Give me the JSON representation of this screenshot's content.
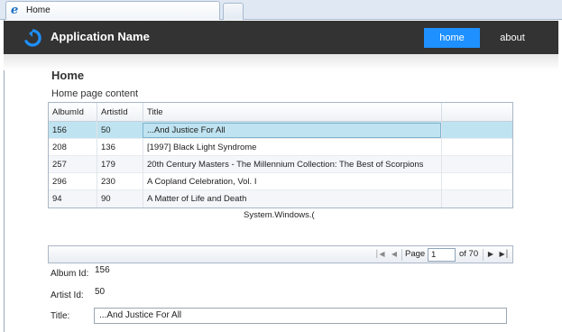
{
  "browser": {
    "tab_label": "Home"
  },
  "header": {
    "app_name": "Application Name",
    "nav": [
      {
        "label": "home",
        "active": true
      },
      {
        "label": "about",
        "active": false
      }
    ],
    "accent": "#1e90ff"
  },
  "page": {
    "title": "Home",
    "content": "Home page content"
  },
  "grid": {
    "columns": [
      "AlbumId",
      "ArtistId",
      "Title"
    ],
    "rows": [
      {
        "album_id": "156",
        "artist_id": "50",
        "title": "...And Justice For All",
        "selected": true
      },
      {
        "album_id": "208",
        "artist_id": "136",
        "title": "[1997] Black Light Syndrome"
      },
      {
        "album_id": "257",
        "artist_id": "179",
        "title": "20th Century Masters - The Millennium Collection: The Best of Scorpions"
      },
      {
        "album_id": "296",
        "artist_id": "230",
        "title": "A Copland Celebration, Vol. I"
      },
      {
        "album_id": "94",
        "artist_id": "90",
        "title": "A Matter of Life and Death"
      }
    ]
  },
  "status_text": "System.Windows.(",
  "pager": {
    "page_label": "Page",
    "current_page": "1",
    "of_label": "of 70"
  },
  "details": {
    "album_id_label": "Album Id:",
    "album_id_value": "156",
    "artist_id_label": "Artist Id:",
    "artist_id_value": "50",
    "title_label": "Title:",
    "title_value": "...And Justice For All"
  }
}
